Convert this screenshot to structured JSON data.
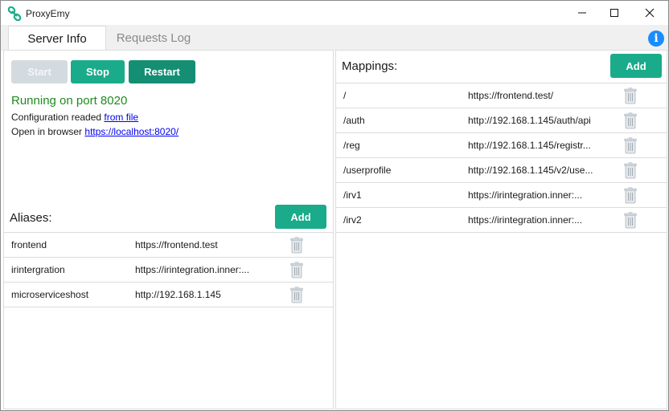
{
  "window": {
    "title": "ProxyEmy",
    "icon": "link-chain-icon",
    "controls": [
      "minimize-icon",
      "maximize-icon",
      "close-icon"
    ]
  },
  "tabs": [
    {
      "label": "Server Info",
      "active": true
    },
    {
      "label": "Requests Log",
      "active": false
    }
  ],
  "server": {
    "start_label": "Start",
    "stop_label": "Stop",
    "restart_label": "Restart",
    "status": "Running on port 8020",
    "config_prefix": "Configuration readed ",
    "config_link": "from file",
    "browser_prefix": "Open in browser ",
    "browser_link": "https://localhost:8020/"
  },
  "aliases": {
    "title": "Aliases:",
    "add_label": "Add",
    "rows": [
      {
        "name": "frontend",
        "value": "https://frontend.test"
      },
      {
        "name": "irintergration",
        "value": "https://irintegration.inner:..."
      },
      {
        "name": "microserviceshost",
        "value": "http://192.168.1.145"
      }
    ]
  },
  "mappings": {
    "title": "Mappings:",
    "add_label": "Add",
    "rows": [
      {
        "path": "/",
        "target": "https://frontend.test/"
      },
      {
        "path": "/auth",
        "target": "http://192.168.1.145/auth/api"
      },
      {
        "path": "/reg",
        "target": "http://192.168.1.145/registr..."
      },
      {
        "path": "/userprofile",
        "target": "http://192.168.1.145/v2/use..."
      },
      {
        "path": "/irv1",
        "target": "https://irintegration.inner:..."
      },
      {
        "path": "/irv2",
        "target": "https://irintegration.inner:..."
      }
    ]
  },
  "colors": {
    "accent": "#1aab8a",
    "accent_dark": "#148f74",
    "disabled": "#d3dbe0",
    "status_green": "#1e8a1e",
    "info_blue": "#1a8cff"
  }
}
